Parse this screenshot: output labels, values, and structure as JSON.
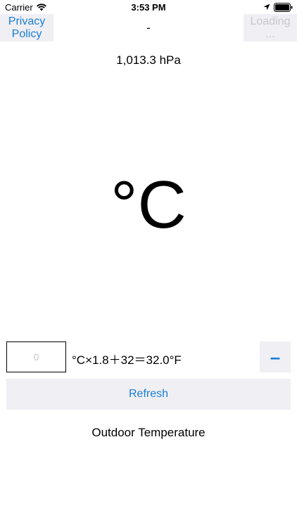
{
  "status_bar": {
    "carrier": "Carrier",
    "time": "3:53 PM",
    "icons": [
      "wifi-icon",
      "location-arrow-icon",
      "battery-icon"
    ]
  },
  "nav": {
    "privacy_label": "Privacy\nPolicy",
    "title": "-",
    "loading_label": "Loading\n..."
  },
  "pressure": "1,013.3 hPa",
  "unit_display": "°C",
  "converter": {
    "input_placeholder": "0",
    "input_value": "",
    "formula": "°C×1.8＋32＝32.0°F",
    "minus_label": "–"
  },
  "refresh_label": "Refresh",
  "outdoor_label": "Outdoor Temperature",
  "colors": {
    "accent": "#1a7fd4",
    "button_bg": "#efeff4",
    "disabled": "#c8c8cc"
  }
}
